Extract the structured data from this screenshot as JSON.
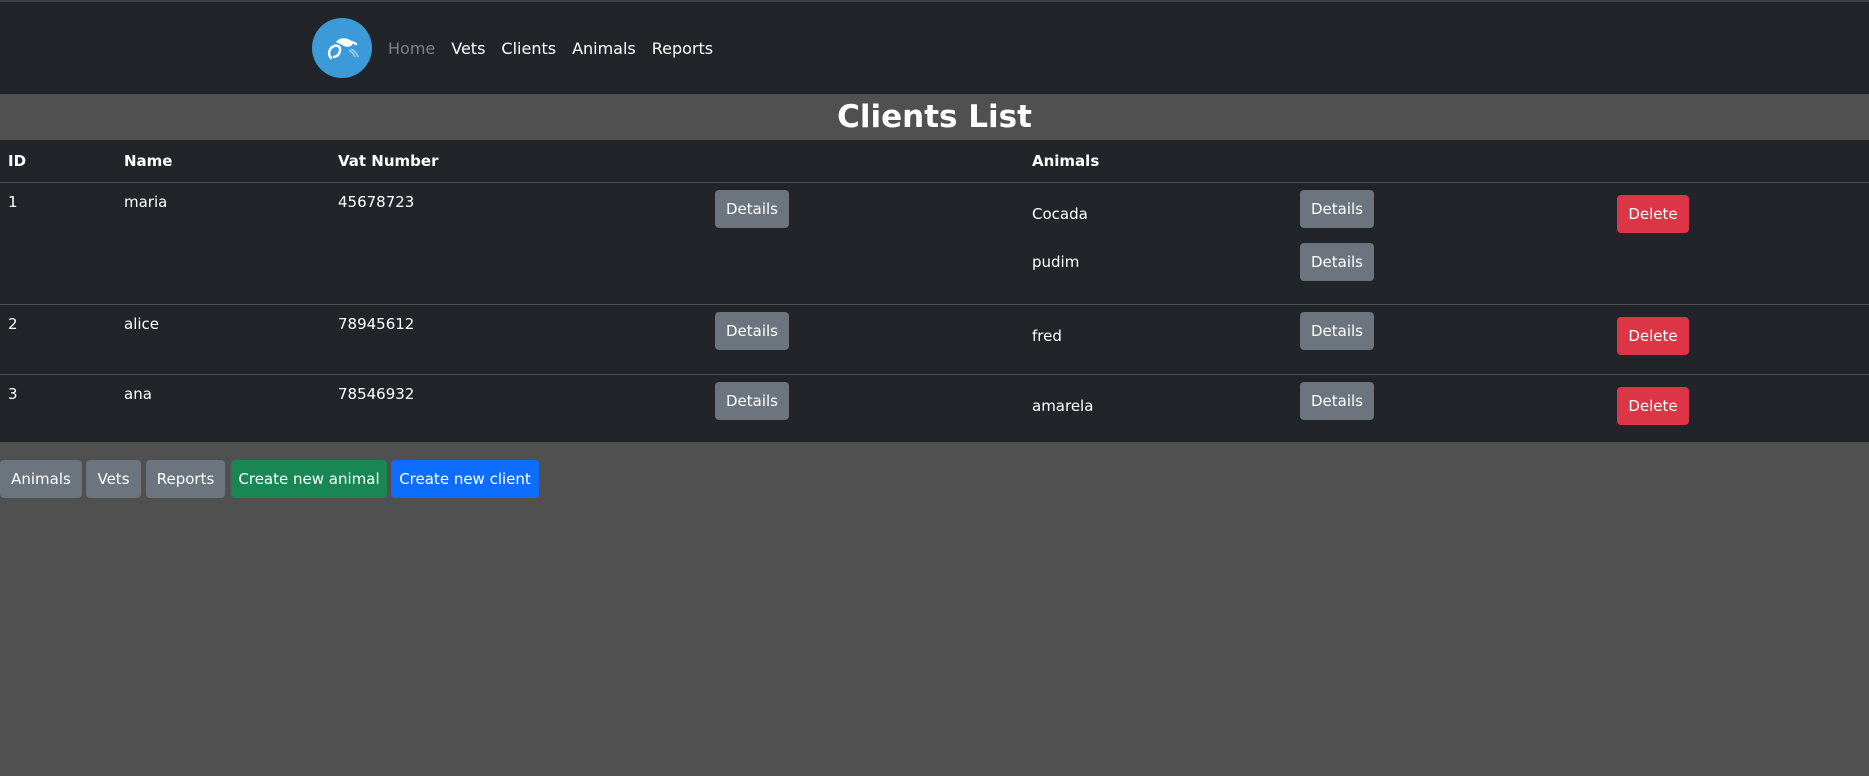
{
  "navbar": {
    "links": [
      "Home",
      "Vets",
      "Clients",
      "Animals",
      "Reports"
    ]
  },
  "page": {
    "title": "Clients List"
  },
  "table": {
    "headers": {
      "id": "ID",
      "name": "Name",
      "vat": "Vat Number",
      "animals": "Animals"
    },
    "rows": [
      {
        "id": "1",
        "name": "maria",
        "vat": "45678723",
        "details_label": "Details",
        "animals": [
          {
            "name": "Cocada",
            "details_label": "Details"
          },
          {
            "name": "pudim",
            "details_label": "Details"
          }
        ],
        "delete_label": "Delete"
      },
      {
        "id": "2",
        "name": "alice",
        "vat": "78945612",
        "details_label": "Details",
        "animals": [
          {
            "name": "fred",
            "details_label": "Details"
          }
        ],
        "delete_label": "Delete"
      },
      {
        "id": "3",
        "name": "ana",
        "vat": "78546932",
        "details_label": "Details",
        "animals": [
          {
            "name": "amarela",
            "details_label": "Details"
          }
        ],
        "delete_label": "Delete"
      }
    ]
  },
  "footer_buttons": {
    "animals": "Animals",
    "vets": "Vets",
    "reports": "Reports",
    "create_animal": "Create new animal",
    "create_client": "Create new client"
  },
  "colors": {
    "navbar_bg": "#212529",
    "page_bg": "#505050",
    "secondary": "#6c757d",
    "danger": "#dc3545",
    "success": "#198754",
    "primary": "#0d6efd",
    "logo": "#3d9ad9"
  }
}
